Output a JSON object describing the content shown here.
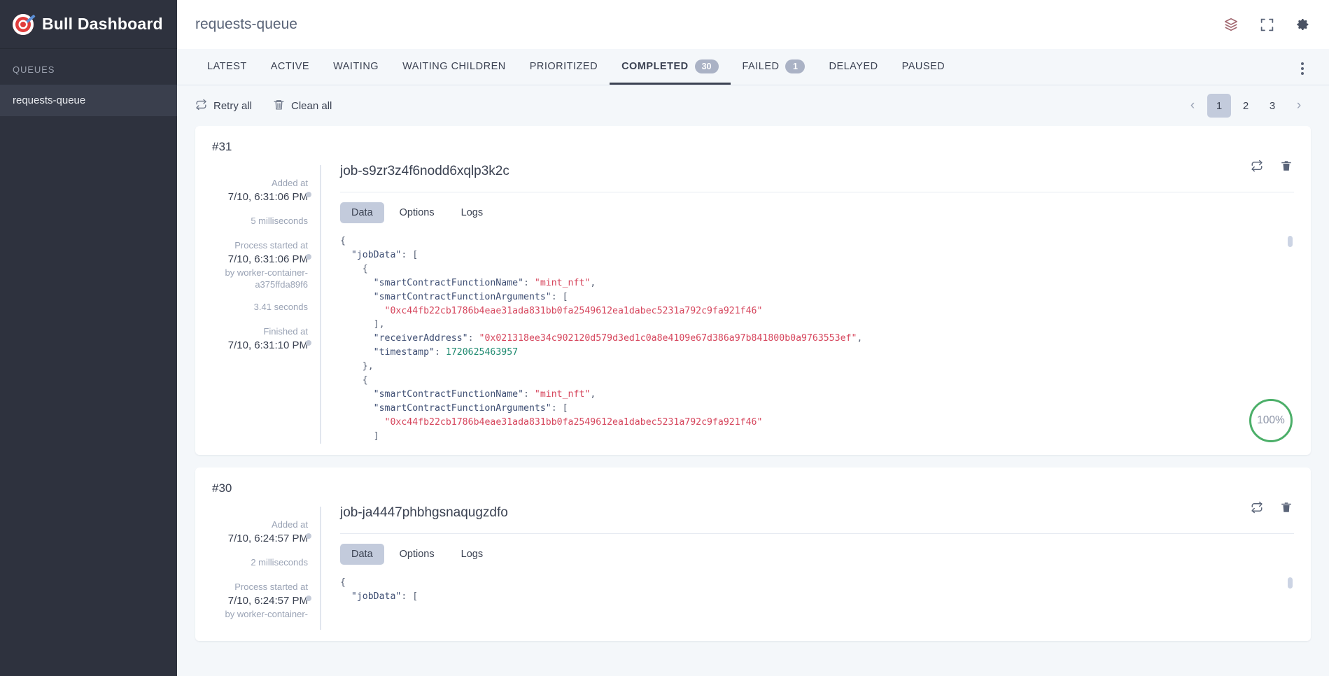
{
  "sidebar": {
    "brand": "Bull Dashboard",
    "brand_logo_icon": "target-dart-icon",
    "section_label": "QUEUES",
    "queues": [
      {
        "name": "requests-queue",
        "selected": true
      }
    ]
  },
  "header": {
    "queue_title": "requests-queue",
    "icons": [
      {
        "name": "redis-stack-icon",
        "glyph": "layers",
        "color": "#a36a72"
      },
      {
        "name": "fullscreen-icon",
        "glyph": "expand",
        "color": "#5a6478"
      },
      {
        "name": "settings-gear-icon",
        "glyph": "gear",
        "color": "#4a5263"
      }
    ]
  },
  "tabs": [
    {
      "id": "latest",
      "label": "LATEST",
      "badge": null,
      "active": false
    },
    {
      "id": "active",
      "label": "ACTIVE",
      "badge": null,
      "active": false
    },
    {
      "id": "waiting",
      "label": "WAITING",
      "badge": null,
      "active": false
    },
    {
      "id": "waiting-children",
      "label": "WAITING CHILDREN",
      "badge": null,
      "active": false
    },
    {
      "id": "prioritized",
      "label": "PRIORITIZED",
      "badge": null,
      "active": false
    },
    {
      "id": "completed",
      "label": "COMPLETED",
      "badge": "30",
      "active": true
    },
    {
      "id": "failed",
      "label": "FAILED",
      "badge": "1",
      "active": false
    },
    {
      "id": "delayed",
      "label": "DELAYED",
      "badge": null,
      "active": false
    },
    {
      "id": "paused",
      "label": "PAUSED",
      "badge": null,
      "active": false
    }
  ],
  "tabs_overflow_icon": "more-vertical-icon",
  "toolbar": {
    "retry_all_label": "Retry all",
    "retry_all_icon": "retry-icon",
    "clean_all_label": "Clean all",
    "clean_all_icon": "trash-icon"
  },
  "pagination": {
    "prev_label": "‹",
    "next_label": "›",
    "pages": [
      "1",
      "2",
      "3"
    ],
    "current": "1"
  },
  "jobs": [
    {
      "number": "#31",
      "name": "job-s9zr3z4f6nodd6xqlp3k2c",
      "added_label": "Added at",
      "added_value": "7/10, 6:31:06 PM",
      "wait_duration": "5 milliseconds",
      "process_label": "Process started at",
      "process_value": "7/10, 6:31:06 PM",
      "worker": "by worker-container-a375ffda89f6",
      "run_duration": "3.41 seconds",
      "finished_label": "Finished at",
      "finished_value": "7/10, 6:31:10 PM",
      "subtabs": [
        {
          "label": "Data",
          "active": true
        },
        {
          "label": "Options",
          "active": false
        },
        {
          "label": "Logs",
          "active": false
        }
      ],
      "actions": [
        {
          "name": "retry-job-icon",
          "glyph": "retry"
        },
        {
          "name": "delete-job-icon",
          "glyph": "trash"
        }
      ],
      "progress": "100%",
      "progress_color": "#4caf69",
      "json_lines": [
        [
          [
            "p",
            "{"
          ]
        ],
        [
          [
            "p",
            "  "
          ],
          [
            "k",
            "\"jobData\""
          ],
          [
            "p",
            ": ["
          ]
        ],
        [
          [
            "p",
            "    {"
          ]
        ],
        [
          [
            "p",
            "      "
          ],
          [
            "k",
            "\"smartContractFunctionName\""
          ],
          [
            "p",
            ": "
          ],
          [
            "s",
            "\"mint_nft\""
          ],
          [
            "p",
            ","
          ]
        ],
        [
          [
            "p",
            "      "
          ],
          [
            "k",
            "\"smartContractFunctionArguments\""
          ],
          [
            "p",
            ": ["
          ]
        ],
        [
          [
            "p",
            "        "
          ],
          [
            "s",
            "\"0xc44fb22cb1786b4eae31ada831bb0fa2549612ea1dabec5231a792c9fa921f46\""
          ]
        ],
        [
          [
            "p",
            "      ],"
          ]
        ],
        [
          [
            "p",
            "      "
          ],
          [
            "k",
            "\"receiverAddress\""
          ],
          [
            "p",
            ": "
          ],
          [
            "s",
            "\"0x021318ee34c902120d579d3ed1c0a8e4109e67d386a97b841800b0a9763553ef\""
          ],
          [
            "p",
            ","
          ]
        ],
        [
          [
            "p",
            "      "
          ],
          [
            "k",
            "\"timestamp\""
          ],
          [
            "p",
            ": "
          ],
          [
            "n",
            "1720625463957"
          ]
        ],
        [
          [
            "p",
            "    },"
          ]
        ],
        [
          [
            "p",
            "    {"
          ]
        ],
        [
          [
            "p",
            "      "
          ],
          [
            "k",
            "\"smartContractFunctionName\""
          ],
          [
            "p",
            ": "
          ],
          [
            "s",
            "\"mint_nft\""
          ],
          [
            "p",
            ","
          ]
        ],
        [
          [
            "p",
            "      "
          ],
          [
            "k",
            "\"smartContractFunctionArguments\""
          ],
          [
            "p",
            ": ["
          ]
        ],
        [
          [
            "p",
            "        "
          ],
          [
            "s",
            "\"0xc44fb22cb1786b4eae31ada831bb0fa2549612ea1dabec5231a792c9fa921f46\""
          ]
        ],
        [
          [
            "p",
            "      ]"
          ]
        ]
      ]
    },
    {
      "number": "#30",
      "name": "job-ja4447phbhgsnaqugzdfo",
      "added_label": "Added at",
      "added_value": "7/10, 6:24:57 PM",
      "wait_duration": "2 milliseconds",
      "process_label": "Process started at",
      "process_value": "7/10, 6:24:57 PM",
      "worker": "by worker-container-",
      "run_duration": "",
      "finished_label": "",
      "finished_value": "",
      "subtabs": [
        {
          "label": "Data",
          "active": true
        },
        {
          "label": "Options",
          "active": false
        },
        {
          "label": "Logs",
          "active": false
        }
      ],
      "actions": [
        {
          "name": "retry-job-icon",
          "glyph": "retry"
        },
        {
          "name": "delete-job-icon",
          "glyph": "trash"
        }
      ],
      "progress": "",
      "progress_color": "#4caf69",
      "json_lines": [
        [
          [
            "p",
            "{"
          ]
        ],
        [
          [
            "p",
            "  "
          ],
          [
            "k",
            "\"jobData\""
          ],
          [
            "p",
            ": ["
          ]
        ]
      ]
    }
  ]
}
